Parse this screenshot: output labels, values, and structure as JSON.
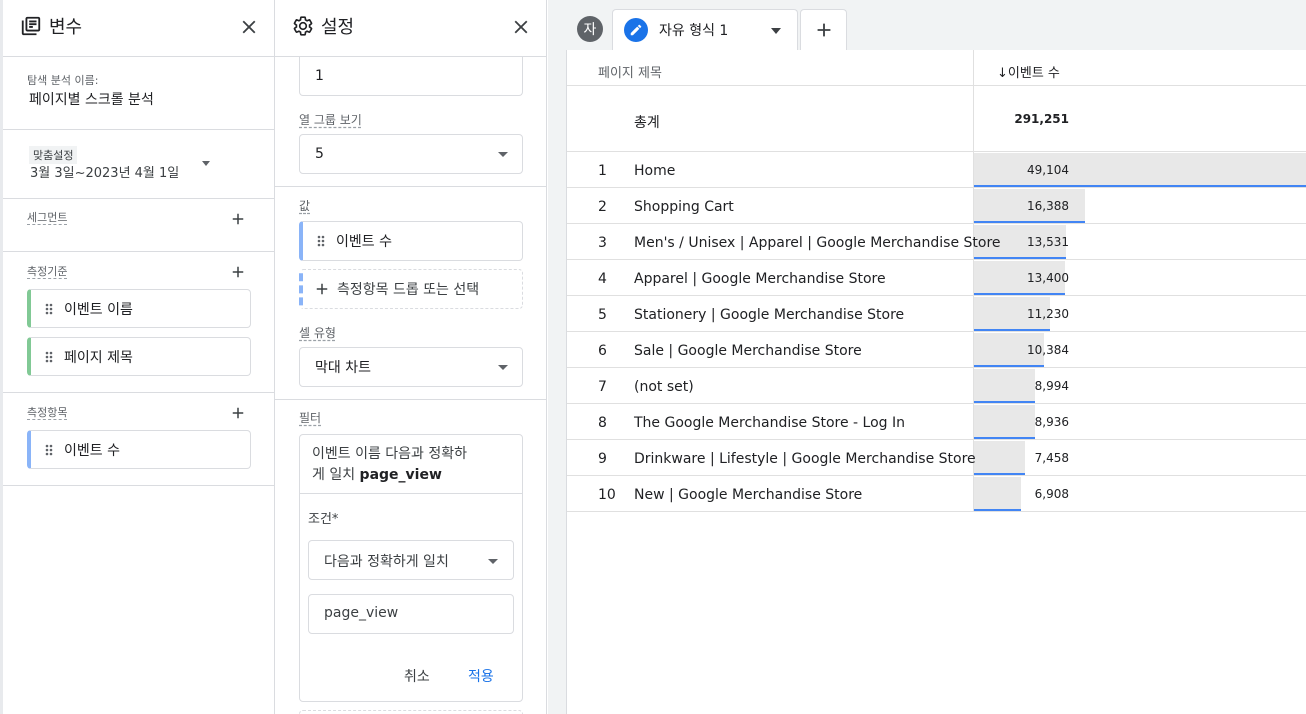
{
  "variables_panel": {
    "title": "변수",
    "exploration_name_label": "탐색 분석 이름:",
    "exploration_name": "페이지별 스크롤 분석",
    "date_badge": "맞춤설정",
    "date_range": "3월 3일~2023년 4월 1일",
    "segments_label": "세그먼트",
    "dimensions_label": "측정기준",
    "dimensions": [
      "이벤트 이름",
      "페이지 제목"
    ],
    "metrics_label": "측정항목",
    "metrics": [
      "이벤트 수"
    ]
  },
  "settings_panel": {
    "title": "설정",
    "top_value": "1",
    "column_group_label": "열 그룹 보기",
    "column_group_value": "5",
    "values_label": "값",
    "value_chip": "이벤트 수",
    "drop_metric": "측정항목 드롭 또는 선택",
    "cell_type_label": "셀 유형",
    "cell_type_value": "막대 차트",
    "filter_label": "필터",
    "filter_summary_line1": "이벤트 이름 다음과 정확하",
    "filter_summary_line2_prefix": "게 일치 ",
    "filter_summary_value": "page_view",
    "condition_label": "조건*",
    "condition_value": "다음과 정확하게 일치",
    "condition_input": "page_view",
    "cancel_label": "취소",
    "apply_label": "적용"
  },
  "canvas": {
    "avatar_letter": "자",
    "tab_label": "자유 형식 1",
    "accent": "#1a73e8",
    "bar_color": "#4285f4",
    "table": {
      "col_page_title": "페이지 제목",
      "col_event_count": "이벤트 수",
      "sort_arrow": "↓",
      "total_label": "총계",
      "total_value": "291,251",
      "rows": [
        {
          "idx": "1",
          "name": "Home",
          "value": "49,104",
          "num": 49104
        },
        {
          "idx": "2",
          "name": "Shopping Cart",
          "value": "16,388",
          "num": 16388
        },
        {
          "idx": "3",
          "name": "Men's / Unisex | Apparel | Google Merchandise Store",
          "value": "13,531",
          "num": 13531
        },
        {
          "idx": "4",
          "name": "Apparel | Google Merchandise Store",
          "value": "13,400",
          "num": 13400
        },
        {
          "idx": "5",
          "name": "Stationery | Google Merchandise Store",
          "value": "11,230",
          "num": 11230
        },
        {
          "idx": "6",
          "name": "Sale | Google Merchandise Store",
          "value": "10,384",
          "num": 10384
        },
        {
          "idx": "7",
          "name": "(not set)",
          "value": "8,994",
          "num": 8994
        },
        {
          "idx": "8",
          "name": "The Google Merchandise Store - Log In",
          "value": "8,936",
          "num": 8936
        },
        {
          "idx": "9",
          "name": "Drinkware | Lifestyle | Google Merchandise Store",
          "value": "7,458",
          "num": 7458
        },
        {
          "idx": "10",
          "name": "New | Google Merchandise Store",
          "value": "6,908",
          "num": 6908
        }
      ]
    }
  }
}
